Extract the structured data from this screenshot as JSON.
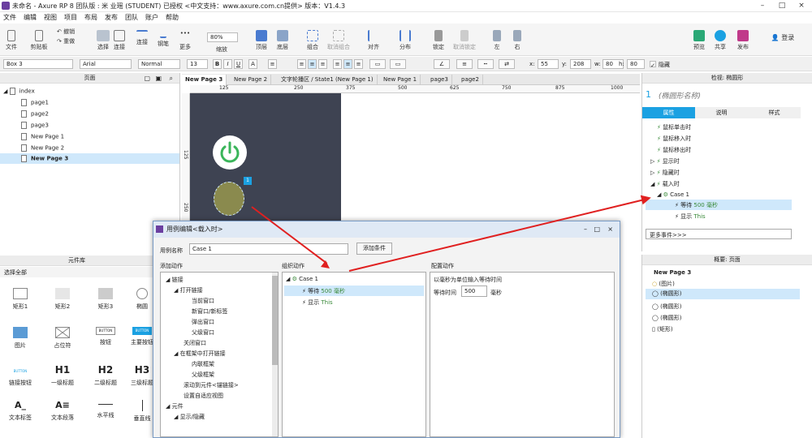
{
  "window": {
    "title": "未命名 - Axure RP 8 团队版 : 米 业瑶 (STUDENT) 已授权   <中文支持：www.axure.com.cn提供> 版本：V1.4.3"
  },
  "menu": [
    "文件",
    "编辑",
    "视图",
    "项目",
    "布局",
    "发布",
    "团队",
    "账户",
    "帮助"
  ],
  "toolbar": {
    "file": "文件",
    "clipboard": "剪贴板",
    "undo": "撤销",
    "redo": "重做",
    "select": "选择",
    "connect": "连接",
    "crop": "钢笔",
    "more": "更多",
    "zoom_value": "80%",
    "zoom_label": "缩放",
    "top": "顶层",
    "bottom": "底层",
    "group": "组合",
    "ungroup": "取消组合",
    "align": "对齐",
    "distribute": "分布",
    "lock": "锁定",
    "unlock": "取消锁定",
    "left": "左",
    "right": "右",
    "preview": "预览",
    "share": "共享",
    "publish": "发布",
    "login": "登录"
  },
  "format": {
    "widget": "Box 3",
    "font": "Arial",
    "style": "Normal",
    "size": "13",
    "x_label": "x:",
    "x": "55",
    "y_label": "y:",
    "y": "208",
    "w_label": "w:",
    "w": "80",
    "h_label": "h:",
    "h": "80",
    "hidden": "隐藏"
  },
  "pages_panel": {
    "title": "页面",
    "items": [
      "index",
      "page1",
      "page2",
      "page3",
      "New Page 1",
      "New Page 2",
      "New Page 3"
    ]
  },
  "widget_panel": {
    "title": "元件库",
    "select_all": "选择全部",
    "widgets": [
      "矩形1",
      "矩形2",
      "矩形3",
      "椭圆",
      "图片",
      "占位符",
      "按钮",
      "主要按钮",
      "链接按钮",
      "一级标题",
      "二级标题",
      "三级标题",
      "文本标签",
      "文本段落",
      "水平线",
      "垂直线"
    ],
    "button_text": "BUTTON",
    "h1": "H1",
    "h2": "H2",
    "h3": "H3"
  },
  "tabs": [
    "New Page 3",
    "New Page 2",
    "文字轮播区 / State1 (New Page 1)",
    "New Page 1",
    "page3",
    "page2"
  ],
  "ruler_ticks": [
    "125",
    "250",
    "375",
    "500",
    "625",
    "750",
    "875",
    "1000"
  ],
  "vruler_ticks": [
    "125",
    "250"
  ],
  "canvas": {
    "badge": "1"
  },
  "inspector": {
    "header": "检视: 椭圆形",
    "number": "1",
    "name_placeholder": "(椭圆形名称)",
    "tabs": [
      "属性",
      "说明",
      "样式"
    ],
    "events": [
      "鼠标单击时",
      "鼠标移入时",
      "鼠标移出时",
      "显示时",
      "隐藏时",
      "载入时"
    ],
    "case": "Case 1",
    "action1": "等待 ",
    "action1_value": "500 毫秒",
    "action2": "显示 ",
    "action2_target": "This",
    "more_events": "更多事件>>>"
  },
  "outline": {
    "header": "概要: 页面",
    "page": "New Page 3",
    "items": [
      "(图片)",
      "(椭圆形)",
      "(椭圆形)",
      "(椭圆形)",
      "(矩形)"
    ]
  },
  "dialog": {
    "title": "用例编辑<载入时>",
    "case_name_label": "用例名称",
    "case_name": "Case 1",
    "add_condition": "添加条件",
    "add_action": "添加动作",
    "organize": "组织动作",
    "configure": "配置动作",
    "actions": [
      "链接",
      "打开链接",
      "当前窗口",
      "新窗口/新标签",
      "弹出窗口",
      "父级窗口",
      "关闭窗口",
      "在框架中打开链接",
      "内联框架",
      "父级框架",
      "滚动到元件<锚链接>",
      "设置自适应视图",
      "元件",
      "显示/隐藏"
    ],
    "case": "Case 1",
    "org1": "等待 ",
    "org1_value": "500 毫秒",
    "org2": "显示 ",
    "org2_target": "This",
    "config_title": "以毫秒为单位输入等待时间",
    "wait_label": "等待时间",
    "wait_value": "500",
    "wait_unit": "毫秒"
  },
  "colors": {
    "accent": "#1ba1e2",
    "canvas_dark": "#3e4352",
    "power_green": "#3ab55a",
    "circle_olive": "#8a8a4e",
    "selected": "#cfe8fb",
    "arrow": "#e02020"
  }
}
